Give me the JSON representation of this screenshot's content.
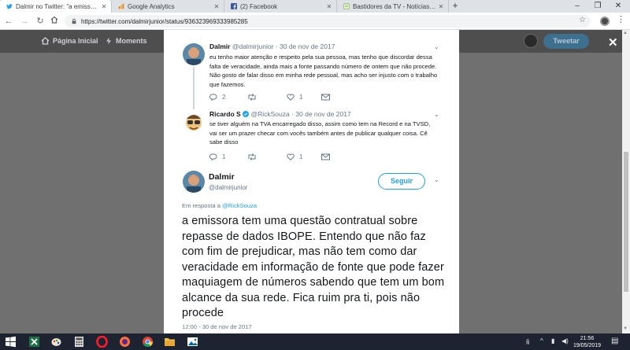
{
  "browser": {
    "tabs": [
      {
        "title": "Dalmir no Twitter: \"a emissora te",
        "icon": "twitter-icon",
        "active": true
      },
      {
        "title": "Google Analytics",
        "icon": "analytics-icon",
        "active": false
      },
      {
        "title": "(2) Facebook",
        "icon": "facebook-icon",
        "active": false
      },
      {
        "title": "Bastidores da TV - Notícias da TV",
        "icon": "page-icon",
        "active": false
      }
    ],
    "new_tab": "+",
    "window_controls": [
      "–",
      "❐",
      "✕"
    ],
    "url": "https://twitter.com/dalmirjunior/status/936323969333985285"
  },
  "twitter_nav": {
    "home": "Página Inicial",
    "moments": "Moments",
    "tweet_button": "Tweetar",
    "close": "✕"
  },
  "replies": [
    {
      "name": "Dalmir",
      "handle": "@dalmirjunior",
      "date": "30 de nov de 2017",
      "text": "eu tenho maior atenção e respeito pela sua pessoa, mas tenho que discordar dessa falta de veracidade, ainda mais a fonte passando número de ontem que não procede. Não gosto de falar disso em minha rede pessoal, mas acho ser injusto com o trabalho que fazemos.",
      "replies_count": "2",
      "retweets_count": "",
      "likes_count": "1"
    },
    {
      "name": "Ricardo S",
      "verified": true,
      "handle": "@RickSouza",
      "date": "30 de nov de 2017",
      "text": "se tiver alguém na TVA encarregado disso, assim como tem na Record e na TVSD, vai ser um prazer checar com vocês também antes de publicar qualquer coisa. Cê sabe disso",
      "replies_count": "1",
      "retweets_count": "",
      "likes_count": "1"
    }
  ],
  "main_tweet": {
    "name": "Dalmir",
    "handle": "@dalmirjunior",
    "follow_label": "Seguir",
    "reply_prefix": "Em resposta a",
    "reply_to": "@RickSouza",
    "text": "a emissora tem uma questão contratual sobre repasse de dados IBOPE. Entendo que não faz com fim de prejudicar, mas não tem como dar veracidade em informação de fonte que pode fazer maquiagem de números sabendo que tem um bom alcance da sua rede. Fica ruim pra ti, pois não procede",
    "timestamp": "12:00 - 30 de nov de 2017"
  },
  "taskbar": {
    "time": "21:56",
    "date": "19/05/2019",
    "apps": [
      "excel-icon",
      "paint-icon",
      "calculator-icon",
      "opera-icon",
      "firefox-icon",
      "chrome-icon",
      "file-explorer-icon",
      "photos-icon"
    ]
  },
  "colors": {
    "twitter_blue": "#1da1f2",
    "overlay_gray": "#707070",
    "nav_dark": "#4e4e4e",
    "taskbar": "#1d2330"
  }
}
